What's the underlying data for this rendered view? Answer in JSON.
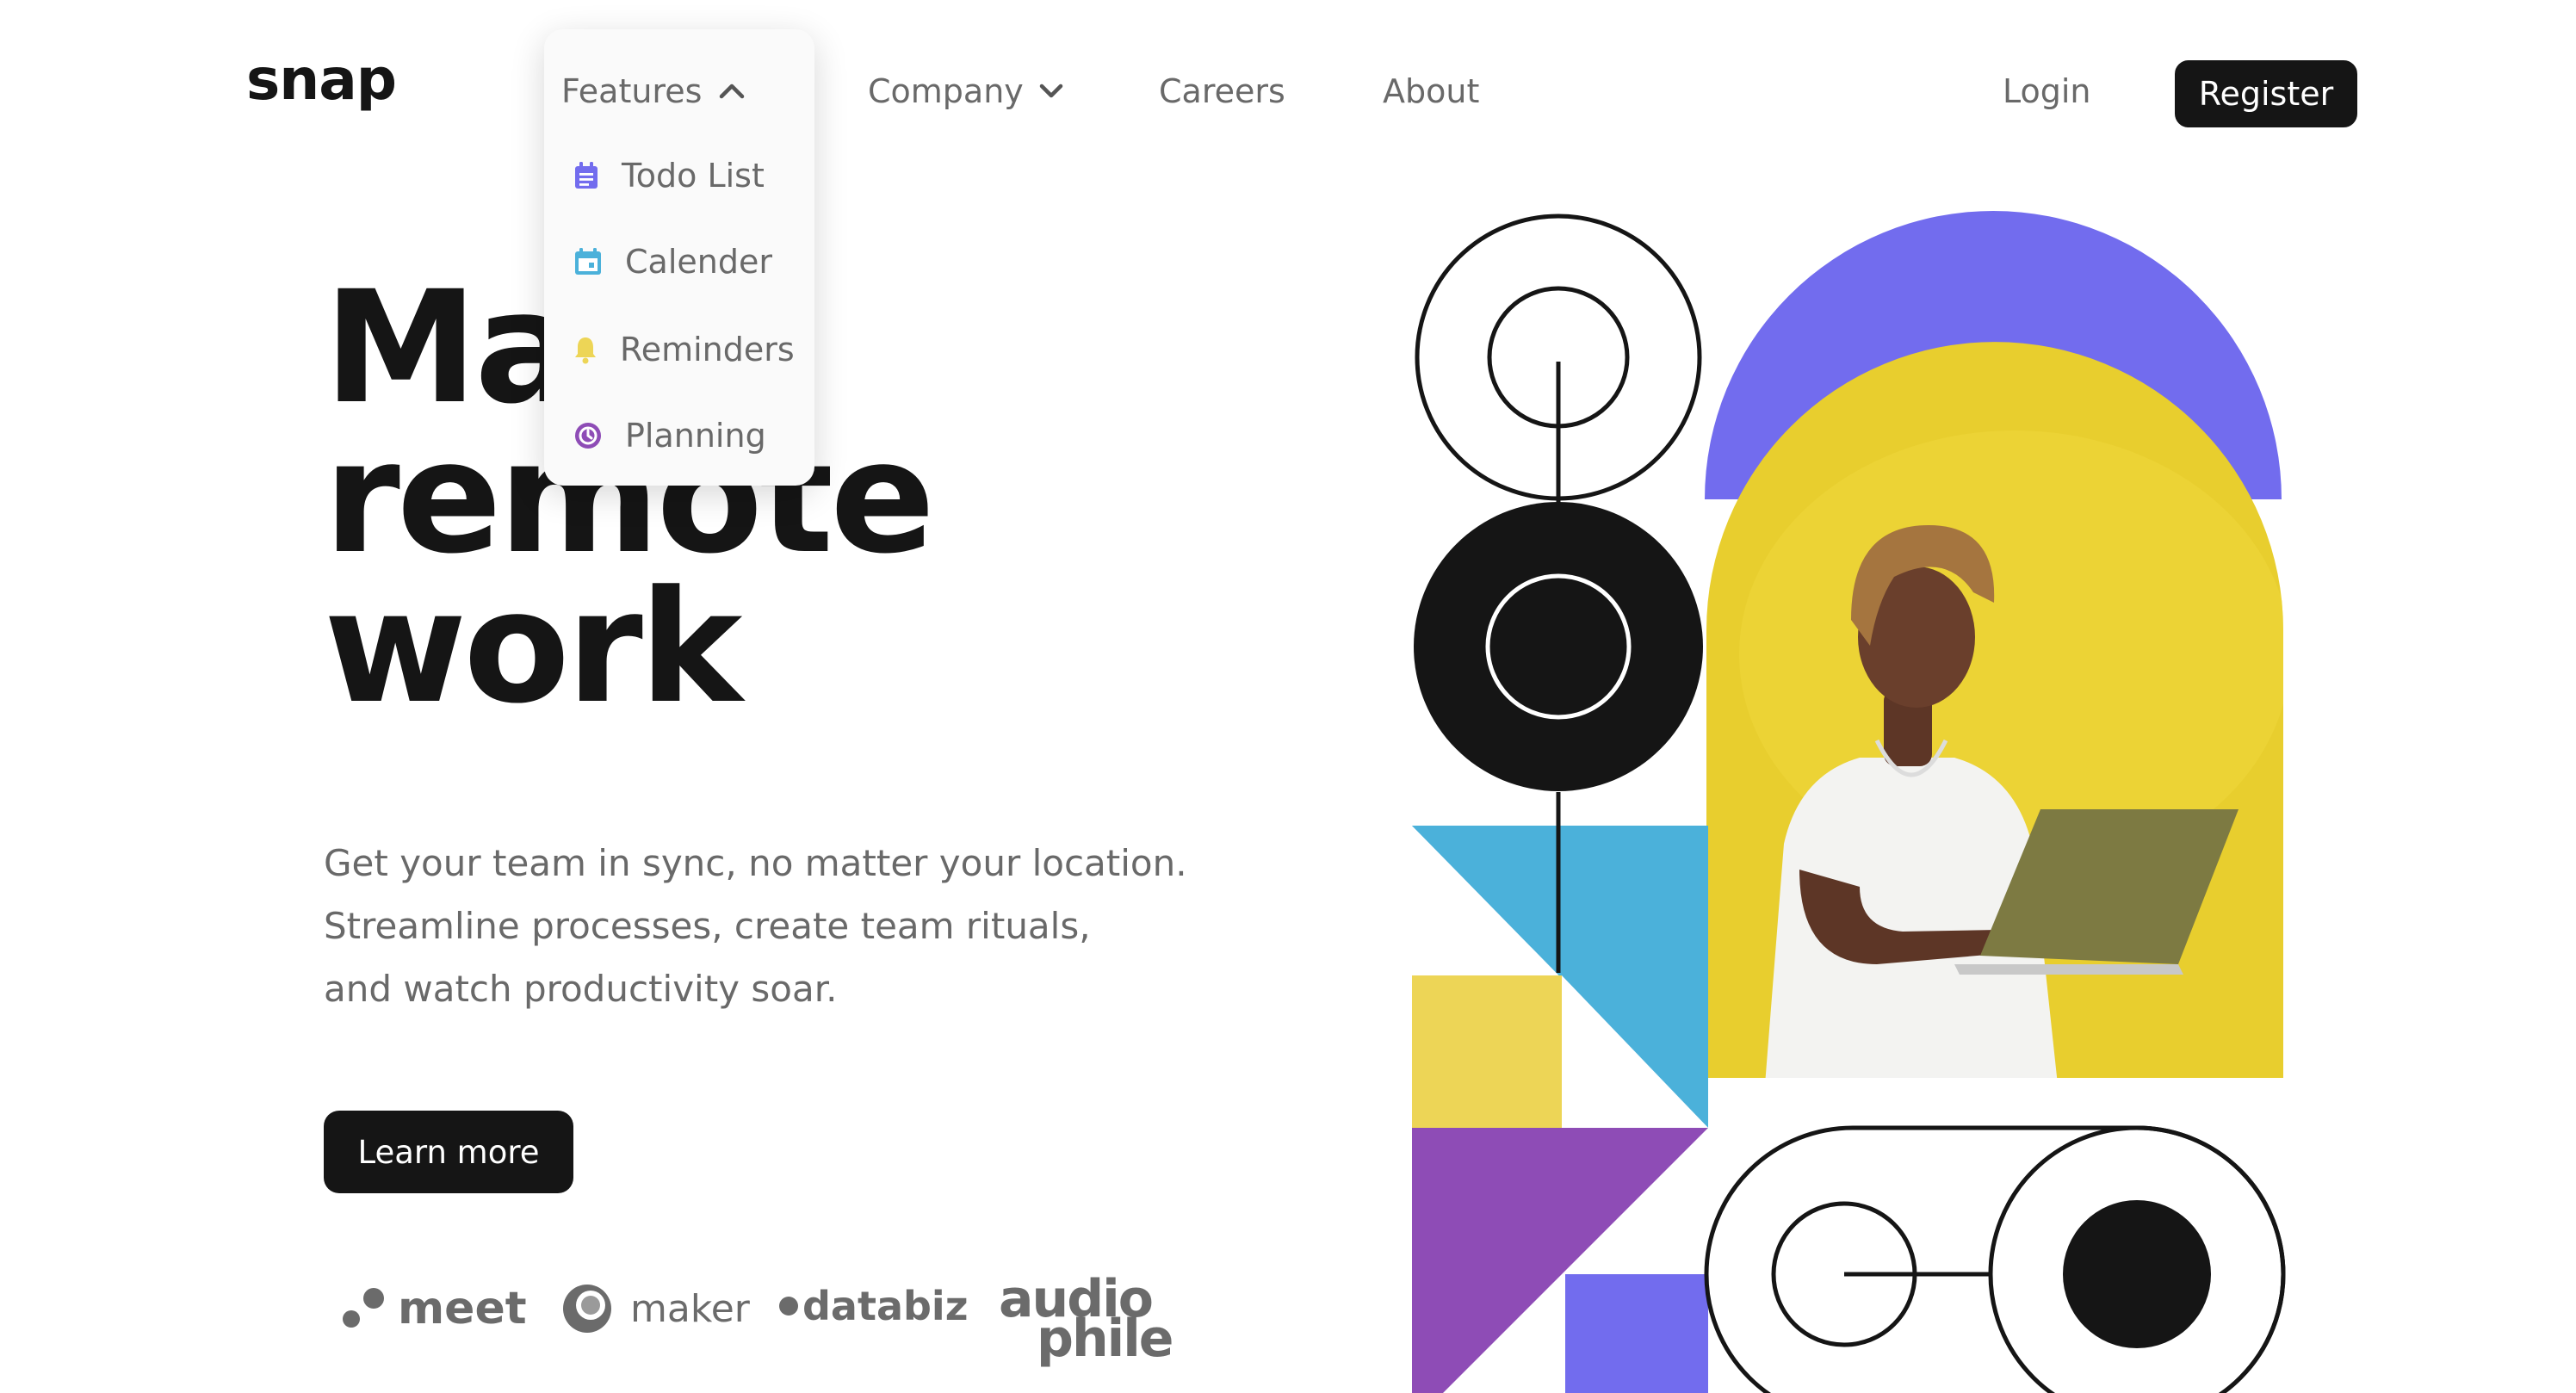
{
  "brand": {
    "logo_text": "snap"
  },
  "nav": {
    "features_label": "Features",
    "company_label": "Company",
    "careers_label": "Careers",
    "about_label": "About",
    "login_label": "Login",
    "register_label": "Register"
  },
  "features_menu": {
    "expanded": true,
    "items": [
      {
        "label": "Todo List",
        "icon": "todo-list-icon",
        "color": "#726CEE"
      },
      {
        "label": "Calender",
        "icon": "calendar-icon",
        "color": "#4BB1DA"
      },
      {
        "label": "Reminders",
        "icon": "bell-icon",
        "color": "#EDD556"
      },
      {
        "label": "Planning",
        "icon": "planning-icon",
        "color": "#8E4CB6"
      }
    ]
  },
  "hero": {
    "title_lines": [
      "Make",
      "remote",
      "work"
    ],
    "subtitle_lines": [
      "Get your team in sync, no matter your location.",
      "Streamline processes, create team rituals,",
      "and watch productivity soar."
    ],
    "cta_label": "Learn more"
  },
  "clients": [
    {
      "name": "meet",
      "icon": "meet-logo"
    },
    {
      "name": "maker",
      "icon": "maker-logo"
    },
    {
      "name": "databiz",
      "icon": "databiz-logo"
    },
    {
      "name_line1": "audio",
      "name_line2": "phile",
      "icon": "audiophile-logo"
    }
  ],
  "colors": {
    "text_dark": "#151515",
    "text_gray": "#696969",
    "purple": "#726CEE",
    "blue": "#4BB1DA",
    "yellow": "#EDD556",
    "violet": "#8E4CB6",
    "photo_bg": "#E8CE2E"
  }
}
